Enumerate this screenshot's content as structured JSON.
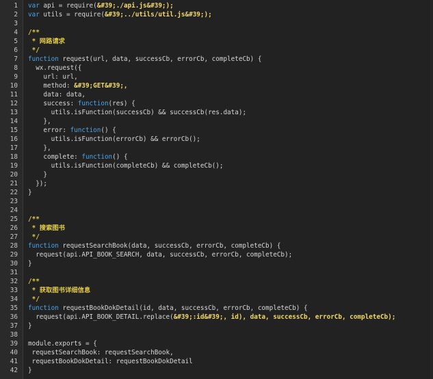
{
  "colors": {
    "background": "#222222",
    "gutter": "#2a2a2a",
    "line_number": "#c8c8c8",
    "keyword": "#4aa4e8",
    "string": "#f3d96a",
    "comment": "#e0c846",
    "plain": "#d8d8d8"
  },
  "lines": [
    {
      "n": "1",
      "tokens": [
        {
          "t": "keyword",
          "v": "var"
        },
        {
          "t": "plain",
          "v": " api = require("
        },
        {
          "t": "string",
          "v": "&#39;./api.js&#39;);"
        }
      ]
    },
    {
      "n": "2",
      "tokens": [
        {
          "t": "keyword",
          "v": "var"
        },
        {
          "t": "plain",
          "v": " utils = require("
        },
        {
          "t": "string",
          "v": "&#39;../utils/util.js&#39;);"
        }
      ]
    },
    {
      "n": "3",
      "tokens": []
    },
    {
      "n": "4",
      "tokens": [
        {
          "t": "comment-bold",
          "v": "/**"
        }
      ]
    },
    {
      "n": "5",
      "tokens": [
        {
          "t": "comment-bold",
          "v": " * 网路请求"
        }
      ]
    },
    {
      "n": "6",
      "tokens": [
        {
          "t": "comment-bold",
          "v": " */"
        }
      ]
    },
    {
      "n": "7",
      "tokens": [
        {
          "t": "keyword",
          "v": "function"
        },
        {
          "t": "plain",
          "v": " request(url, data, successCb, errorCb, completeCb) {"
        }
      ]
    },
    {
      "n": "8",
      "tokens": [
        {
          "t": "plain",
          "v": "  wx.request({"
        }
      ]
    },
    {
      "n": "9",
      "tokens": [
        {
          "t": "plain",
          "v": "    url: url,"
        }
      ]
    },
    {
      "n": "10",
      "tokens": [
        {
          "t": "plain",
          "v": "    method: "
        },
        {
          "t": "string",
          "v": "&#39;GET&#39;,"
        }
      ]
    },
    {
      "n": "11",
      "tokens": [
        {
          "t": "plain",
          "v": "    data: data,"
        }
      ]
    },
    {
      "n": "12",
      "tokens": [
        {
          "t": "plain",
          "v": "    success: "
        },
        {
          "t": "keyword",
          "v": "function"
        },
        {
          "t": "plain",
          "v": "(res) {"
        }
      ]
    },
    {
      "n": "13",
      "tokens": [
        {
          "t": "plain",
          "v": "      utils.isFunction(successCb) && successCb(res.data);"
        }
      ]
    },
    {
      "n": "14",
      "tokens": [
        {
          "t": "plain",
          "v": "    },"
        }
      ]
    },
    {
      "n": "15",
      "tokens": [
        {
          "t": "plain",
          "v": "    error: "
        },
        {
          "t": "keyword",
          "v": "function"
        },
        {
          "t": "plain",
          "v": "() {"
        }
      ]
    },
    {
      "n": "16",
      "tokens": [
        {
          "t": "plain",
          "v": "      utils.isFunction(errorCb) && errorCb();"
        }
      ]
    },
    {
      "n": "17",
      "tokens": [
        {
          "t": "plain",
          "v": "    },"
        }
      ]
    },
    {
      "n": "18",
      "tokens": [
        {
          "t": "plain",
          "v": "    complete: "
        },
        {
          "t": "keyword",
          "v": "function"
        },
        {
          "t": "plain",
          "v": "() {"
        }
      ]
    },
    {
      "n": "19",
      "tokens": [
        {
          "t": "plain",
          "v": "      utils.isFunction(completeCb) && completeCb();"
        }
      ]
    },
    {
      "n": "20",
      "tokens": [
        {
          "t": "plain",
          "v": "    }"
        }
      ]
    },
    {
      "n": "21",
      "tokens": [
        {
          "t": "plain",
          "v": "  });"
        }
      ]
    },
    {
      "n": "22",
      "tokens": [
        {
          "t": "plain",
          "v": "}"
        }
      ]
    },
    {
      "n": "23",
      "tokens": []
    },
    {
      "n": "24",
      "tokens": []
    },
    {
      "n": "25",
      "tokens": [
        {
          "t": "comment-bold",
          "v": "/**"
        }
      ]
    },
    {
      "n": "26",
      "tokens": [
        {
          "t": "comment-bold",
          "v": " * 搜索图书"
        }
      ]
    },
    {
      "n": "27",
      "tokens": [
        {
          "t": "comment-bold",
          "v": " */"
        }
      ]
    },
    {
      "n": "28",
      "tokens": [
        {
          "t": "keyword",
          "v": "function"
        },
        {
          "t": "plain",
          "v": " requestSearchBook(data, successCb, errorCb, completeCb) {"
        }
      ]
    },
    {
      "n": "29",
      "tokens": [
        {
          "t": "plain",
          "v": "  request(api.API_BOOK_SEARCH, data, successCb, errorCb, completeCb);"
        }
      ]
    },
    {
      "n": "30",
      "tokens": [
        {
          "t": "plain",
          "v": "}"
        }
      ]
    },
    {
      "n": "31",
      "tokens": []
    },
    {
      "n": "32",
      "tokens": [
        {
          "t": "comment-bold",
          "v": "/**"
        }
      ]
    },
    {
      "n": "33",
      "tokens": [
        {
          "t": "comment-bold",
          "v": " * 获取图书详细信息"
        }
      ]
    },
    {
      "n": "34",
      "tokens": [
        {
          "t": "comment-bold",
          "v": " */"
        }
      ]
    },
    {
      "n": "35",
      "tokens": [
        {
          "t": "keyword",
          "v": "function"
        },
        {
          "t": "plain",
          "v": " requestBookDokDetail(id, data, successCb, errorCb, completeCb) {"
        }
      ]
    },
    {
      "n": "36",
      "tokens": [
        {
          "t": "plain",
          "v": "  request(api.API_BOOK_DETAIL.replace("
        },
        {
          "t": "string",
          "v": "&#39;:id&#39;, id), data, successCb, errorCb, completeCb);"
        }
      ]
    },
    {
      "n": "37",
      "tokens": [
        {
          "t": "plain",
          "v": "}"
        }
      ]
    },
    {
      "n": "38",
      "tokens": []
    },
    {
      "n": "39",
      "tokens": [
        {
          "t": "plain",
          "v": "module.exports = {"
        }
      ]
    },
    {
      "n": "40",
      "tokens": [
        {
          "t": "plain",
          "v": " requestSearchBook: requestSearchBook,"
        }
      ]
    },
    {
      "n": "41",
      "tokens": [
        {
          "t": "plain",
          "v": " requestBookDokDetail: requestBookDokDetail"
        }
      ]
    },
    {
      "n": "42",
      "tokens": [
        {
          "t": "plain",
          "v": "}"
        }
      ]
    }
  ]
}
